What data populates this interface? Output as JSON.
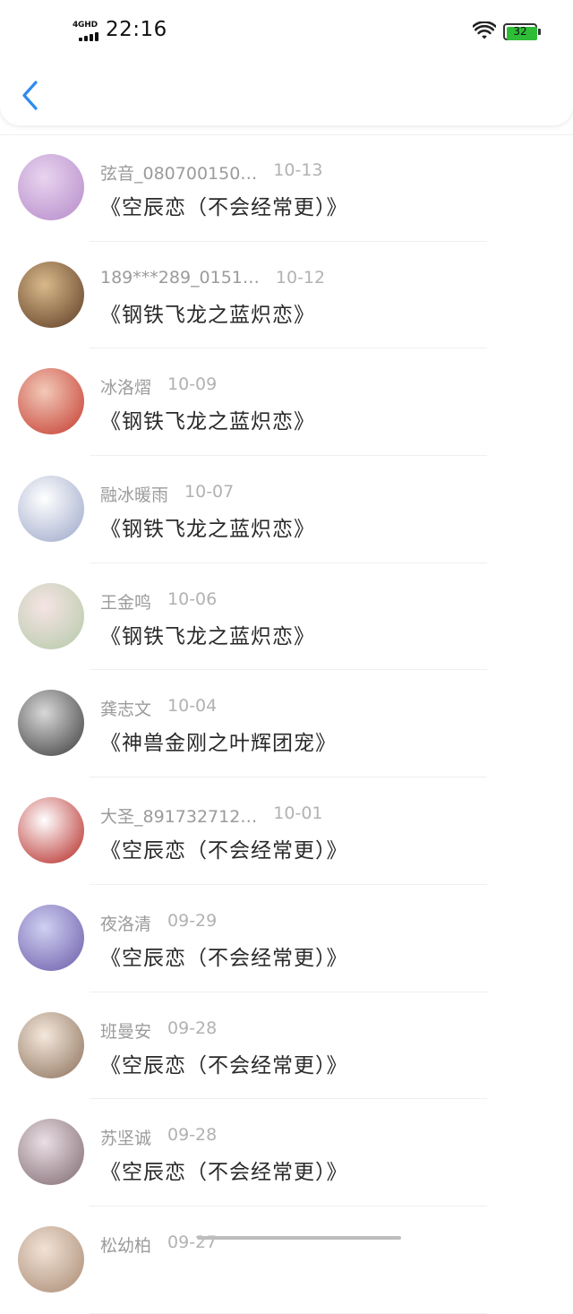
{
  "status_bar": {
    "network": "4GHD",
    "time": "22:16",
    "battery_level": "32",
    "battery_color": "#2fbd38"
  },
  "header": {
    "back_icon": "chevron-left-icon",
    "accent_color": "#2d8cf0"
  },
  "items": [
    {
      "name": "弦音_080700150…",
      "date": "10-13",
      "title": "《空辰恋（不会经常更）》",
      "avatar_colors": [
        "#e8d4ef",
        "#b58ac9"
      ]
    },
    {
      "name": "189***289_0151…",
      "date": "10-12",
      "title": "《钢铁飞龙之蓝炽恋》",
      "avatar_colors": [
        "#d9b98a",
        "#5c3b24"
      ]
    },
    {
      "name": "冰洛熠",
      "date": "10-09",
      "title": "《钢铁飞龙之蓝炽恋》",
      "avatar_colors": [
        "#f2c9b8",
        "#c43a2e"
      ]
    },
    {
      "name": "融冰暖雨",
      "date": "10-07",
      "title": "《钢铁飞龙之蓝炽恋》",
      "avatar_colors": [
        "#ffffff",
        "#9aa5c8"
      ]
    },
    {
      "name": "王金鸣",
      "date": "10-06",
      "title": "《钢铁飞龙之蓝炽恋》",
      "avatar_colors": [
        "#f6e4e4",
        "#b3c9a8"
      ]
    },
    {
      "name": "龚志文",
      "date": "10-04",
      "title": "《神兽金刚之叶辉团宠》",
      "avatar_colors": [
        "#d8d8d8",
        "#3a3a3a"
      ]
    },
    {
      "name": "大圣_891732712…",
      "date": "10-01",
      "title": "《空辰恋（不会经常更）》",
      "avatar_colors": [
        "#ffffff",
        "#b3231f"
      ]
    },
    {
      "name": "夜洛清",
      "date": "09-29",
      "title": "《空辰恋（不会经常更）》",
      "avatar_colors": [
        "#cfd0f2",
        "#6b5aa8"
      ]
    },
    {
      "name": "班曼安",
      "date": "09-28",
      "title": "《空辰恋（不会经常更）》",
      "avatar_colors": [
        "#f4e8dc",
        "#8a6f58"
      ]
    },
    {
      "name": "苏坚诚",
      "date": "09-28",
      "title": "《空辰恋（不会经常更）》",
      "avatar_colors": [
        "#eadfe4",
        "#7e6870"
      ]
    },
    {
      "name": "松幼柏",
      "date": "09-27",
      "title": "",
      "avatar_colors": [
        "#f1e2d6",
        "#a98a72"
      ]
    }
  ]
}
